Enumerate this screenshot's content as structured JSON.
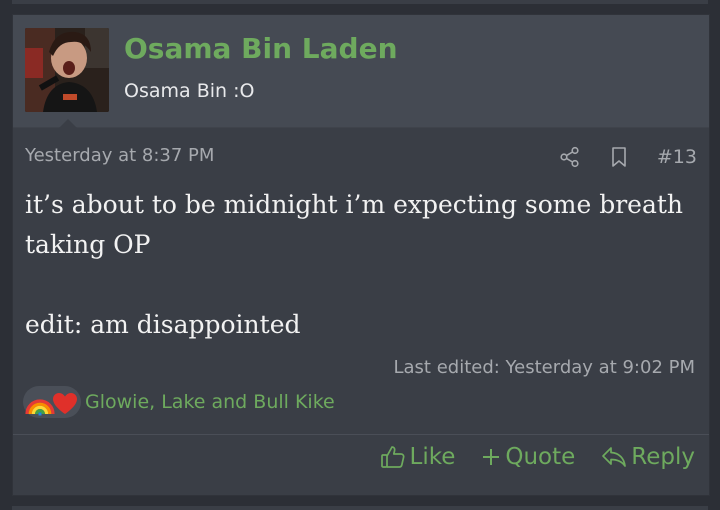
{
  "post": {
    "username": "Osama Bin Laden",
    "user_title": "Osama Bin :O",
    "timestamp": "Yesterday at 8:37 PM",
    "post_number": "#13",
    "message_lines": [
      "it’s about to be midnight i’m expecting some breath",
      "taking OP",
      "",
      "edit: am disappointed"
    ],
    "last_edited": "Last edited: Yesterday at 9:02 PM",
    "reactions": {
      "icons": [
        "rainbow-icon",
        "heart-icon"
      ],
      "text": "Glowie, Lake and Bull Kike"
    },
    "actions": {
      "like": "Like",
      "quote": "Quote",
      "reply": "Reply"
    }
  },
  "colors": {
    "accent": "#6eaa5e",
    "header_bg": "#454a53",
    "post_bg": "#3a3e46",
    "page_bg": "#2c2f36",
    "muted_text": "#a6a9ae",
    "body_text": "#f2f2f2",
    "heart": "#e0302a"
  }
}
